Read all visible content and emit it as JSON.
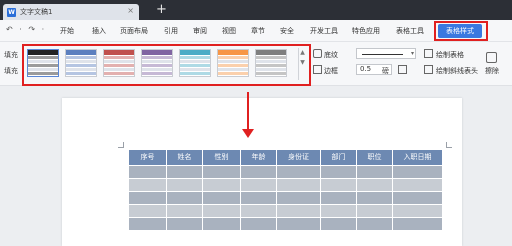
{
  "window": {
    "doc_tab_title": "文字文稿1",
    "tab_close_glyph": "×",
    "new_tab_glyph": "+"
  },
  "menubar": {
    "undo_group": "↶ · ↷ ·",
    "items": [
      "开始",
      "插入",
      "页面布局",
      "引用",
      "审阅",
      "视图",
      "章节",
      "安全",
      "开发工具",
      "特色应用",
      "表格工具"
    ],
    "active_item": "表格样式",
    "active_color": "#3a78e0"
  },
  "ribbon": {
    "row_labels": [
      "填充",
      "填充"
    ],
    "shading_label": "底纹",
    "border_label": "边框",
    "draw_table_label": "绘制表格",
    "draw_diagonal_label": "绘制斜线表头",
    "erase_label": "擦除",
    "line_weight_value": "0.5",
    "line_weight_unit": "磅",
    "scroll_up": "▲",
    "scroll_down": "▼",
    "swatch_colors": [
      "#222222",
      "#5b7fbf",
      "#c0504d",
      "#8064a2",
      "#4bacc6",
      "#f79646",
      "#7f7f7f"
    ]
  },
  "table": {
    "headers": [
      "序号",
      "姓名",
      "性别",
      "年龄",
      "身份证",
      "部门",
      "职位",
      "入职日期"
    ],
    "header_color": "#6d89b2",
    "row_colors": [
      "#a9b2bf",
      "#c7ccd3",
      "#a9b2bf",
      "#c7ccd3",
      "#a9b2bf"
    ]
  },
  "annotations": {
    "highlight_color": "#e02020"
  }
}
